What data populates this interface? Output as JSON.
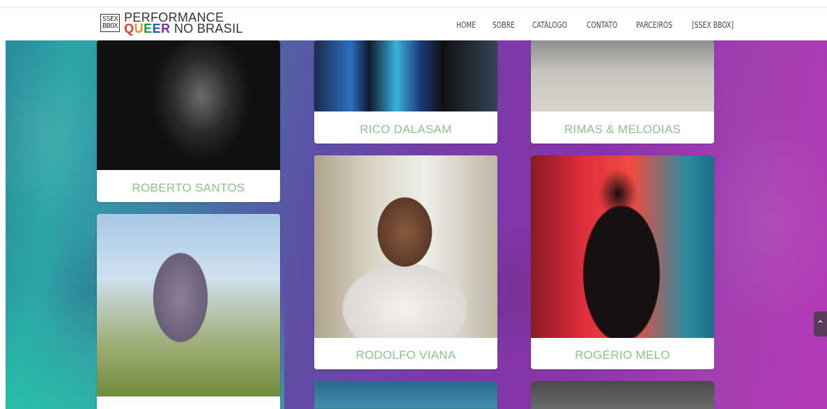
{
  "header": {
    "logo_box_line1": "SSEX",
    "logo_box_line2": "BBOX",
    "logo_line1": "PERFORMANCE",
    "logo_queer": [
      "Q",
      "U",
      "E",
      "E",
      "R"
    ],
    "logo_line2_rest": "NO BRASIL"
  },
  "nav": {
    "items": [
      "HOME",
      "SOBRE",
      "CATÁLOGO",
      "CONTATO",
      "PARCEIROS",
      "[SSEX BBOX]"
    ]
  },
  "cards": {
    "roberto": "ROBERTO SANTOS",
    "rico": "RICO DALASAM",
    "rimas": "RIMAS & MELODIAS",
    "rodolfo": "RODOLFO VIANA",
    "rogerio": "ROGÉRIO MELO"
  },
  "scroll_top_icon": "chevron-up-icon",
  "colors": {
    "label": "#8cc28e",
    "gradient_left": "#2aa6a7",
    "gradient_right": "#b53ab8"
  }
}
